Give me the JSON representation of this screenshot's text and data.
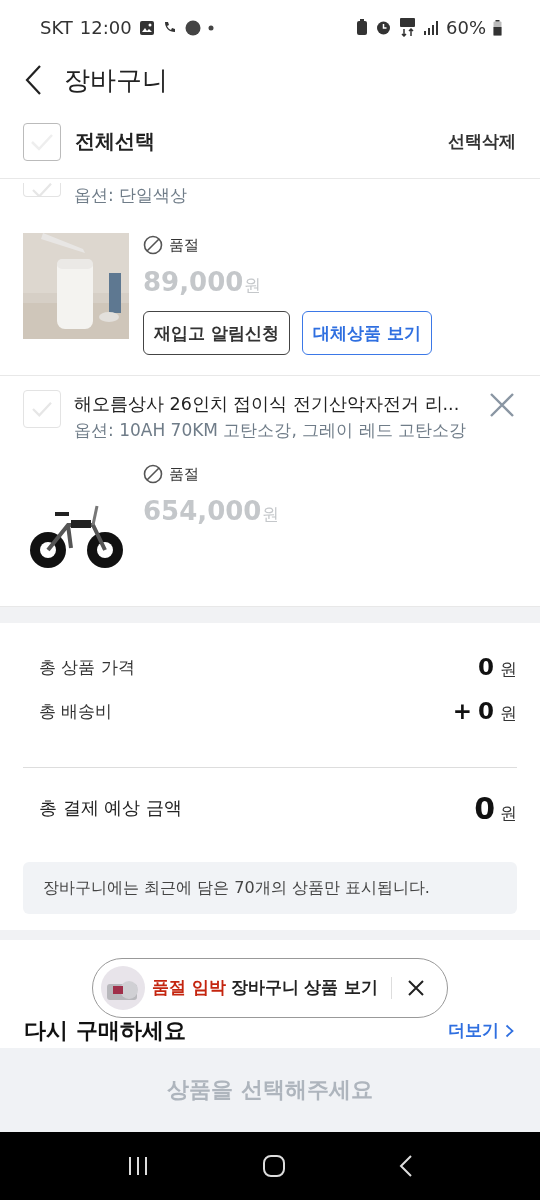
{
  "status_bar": {
    "carrier": "SKT",
    "time": "12:00",
    "battery": "60%"
  },
  "header": {
    "title": "장바구니"
  },
  "select_all": {
    "label": "전체선택",
    "checked": false,
    "delete_label": "선택삭제"
  },
  "items": [
    {
      "option": "옵션: 단일색상",
      "checked": false,
      "status": "품절",
      "price": "89,000",
      "currency": "원",
      "buttons": [
        {
          "label": "재입고 알림신청",
          "kind": "outline"
        },
        {
          "label": "대체상품 보기",
          "kind": "primary"
        }
      ]
    },
    {
      "name": "해오름상사 26인치 접이식 전기산악자전거 리...",
      "option": "옵션: 10AH 70KM 고탄소강, 그레이 레드 고탄소강",
      "checked": false,
      "status": "품절",
      "price": "654,000",
      "currency": "원",
      "removable": true
    }
  ],
  "summary": [
    {
      "label": "총 상품 가격",
      "value": "0",
      "unit": "원"
    },
    {
      "label": "총 배송비",
      "prefix": "+",
      "value": "0",
      "unit": "원"
    }
  ],
  "total": {
    "label": "총 결제 예상 금액",
    "value": "0",
    "unit": "원"
  },
  "notice": "장바구니에는 최근에 담은 70개의 상품만 표시됩니다.",
  "section": {
    "title": "다시 구매하세요",
    "more": "더보기"
  },
  "toast": {
    "highlight": "품절 임박",
    "text": "장바구니 상품 보기"
  },
  "cta": {
    "label": "상품을 선택해주세요",
    "disabled": true
  }
}
